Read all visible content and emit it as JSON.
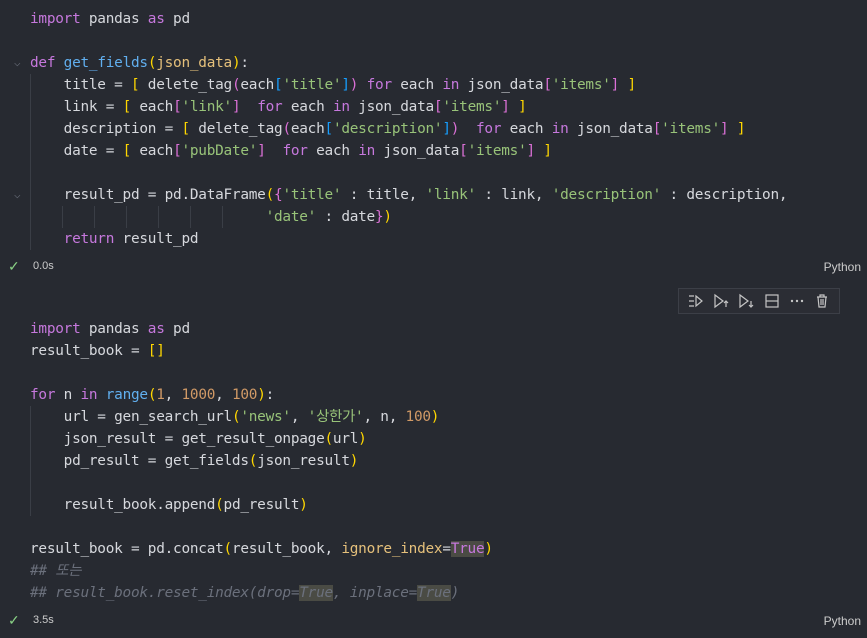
{
  "cell1": {
    "exec_time": "0.0s",
    "language": "Python"
  },
  "cell2": {
    "exec_time": "3.5s",
    "language": "Python"
  },
  "toolbar": {
    "icons": [
      "run-by-line-icon",
      "execute-above-icon",
      "execute-below-icon",
      "split-cell-icon",
      "more-icon",
      "delete-icon"
    ]
  },
  "colors": {
    "background": "#272a31",
    "keyword": "#c678dd",
    "function": "#61afef",
    "string": "#98c379",
    "number": "#d19a66",
    "parameter": "#e5c07b",
    "comment": "#6b707c",
    "success": "#89d185"
  }
}
